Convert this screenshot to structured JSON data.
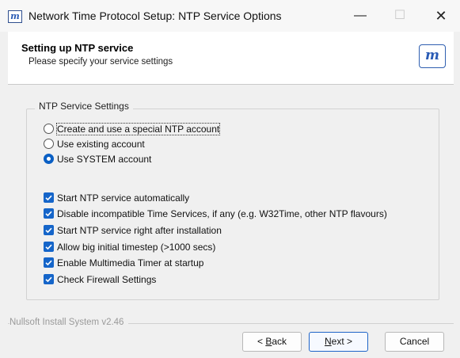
{
  "window": {
    "title": "Network Time Protocol Setup: NTP Service Options",
    "icon_glyph": "m",
    "controls": {
      "minimize": "—",
      "maximize": "☐",
      "close": "✕"
    }
  },
  "header": {
    "title": "Setting up NTP service",
    "subtitle": "Please specify your service settings",
    "logo_glyph": "m"
  },
  "group": {
    "legend": "NTP Service Settings",
    "radios": [
      {
        "label": "Create and use a special NTP account",
        "checked": false,
        "focused": true
      },
      {
        "label": "Use existing account",
        "checked": false
      },
      {
        "label": "Use SYSTEM account",
        "checked": true
      }
    ],
    "checkboxes": [
      {
        "label": "Start NTP service automatically",
        "checked": true
      },
      {
        "label": "Disable incompatible Time Services, if any (e.g. W32Time, other NTP flavours)",
        "checked": true
      },
      {
        "label": "Start NTP service right after installation",
        "checked": true
      },
      {
        "label": "Allow big initial timestep (>1000 secs)",
        "checked": true
      },
      {
        "label": "Enable Multimedia Timer at startup",
        "checked": true
      },
      {
        "label": "Check Firewall Settings",
        "checked": true
      }
    ]
  },
  "footer": {
    "brand": "Nullsoft Install System v2.46",
    "back_prefix": "< ",
    "back_key": "B",
    "back_rest": "ack",
    "next_key": "N",
    "next_rest": "ext >",
    "cancel_label": "Cancel"
  },
  "colors": {
    "accent": "#1565c9",
    "window_bg": "#f0f0f0",
    "header_bg": "#ffffff"
  }
}
